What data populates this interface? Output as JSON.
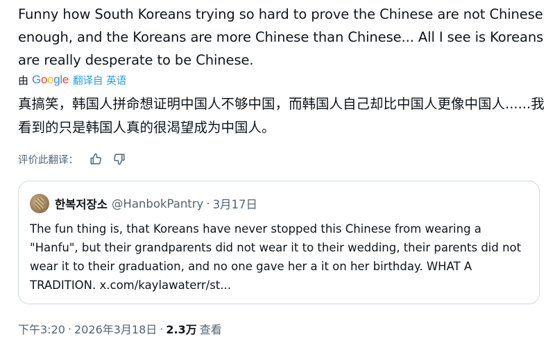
{
  "tweet": {
    "text": "Funny how South Koreans trying so hard to prove the Chinese are not Chinese enough, and the Koreans are more Chinese than Chinese... All I see is Koreans are really desperate to be Chinese.",
    "translated_by_label": "由",
    "google_logo": [
      "G",
      "o",
      "o",
      "g",
      "l",
      "e"
    ],
    "translate_from_label": "翻译自 英语",
    "translated_text": "真搞笑，韩国人拼命想证明中国人不够中国，而韩国人自己却比中国人更像中国人......我看到的只是韩国人真的很渴望成为中国人。",
    "rate_label": "评价此翻译：",
    "icons": {
      "thumbs_up": "thumbs-up-icon",
      "thumbs_down": "thumbs-down-icon"
    }
  },
  "quote": {
    "name": "한복저장소",
    "handle": "@HanbokPantry",
    "dot": "·",
    "date": "3月17日",
    "text": "The fun thing is, that Koreans have never stopped this Chinese from wearing a \"Hanfu\", but their grandparents did not wear it to their wedding, their parents did not wear it to their graduation, and no one gave her a it on her birthday. WHAT A TRADITION. x.com/kaylawaterr/st..."
  },
  "meta": {
    "time": "下午3:20",
    "sep1": "·",
    "date": "2026年3月18日",
    "sep2": "·",
    "views_count": "2.3万",
    "views_label": "查看"
  },
  "colors": {
    "text_primary": "#0f1419",
    "text_secondary": "#536471",
    "link": "#1d9bf0",
    "border": "#cfd9de"
  }
}
